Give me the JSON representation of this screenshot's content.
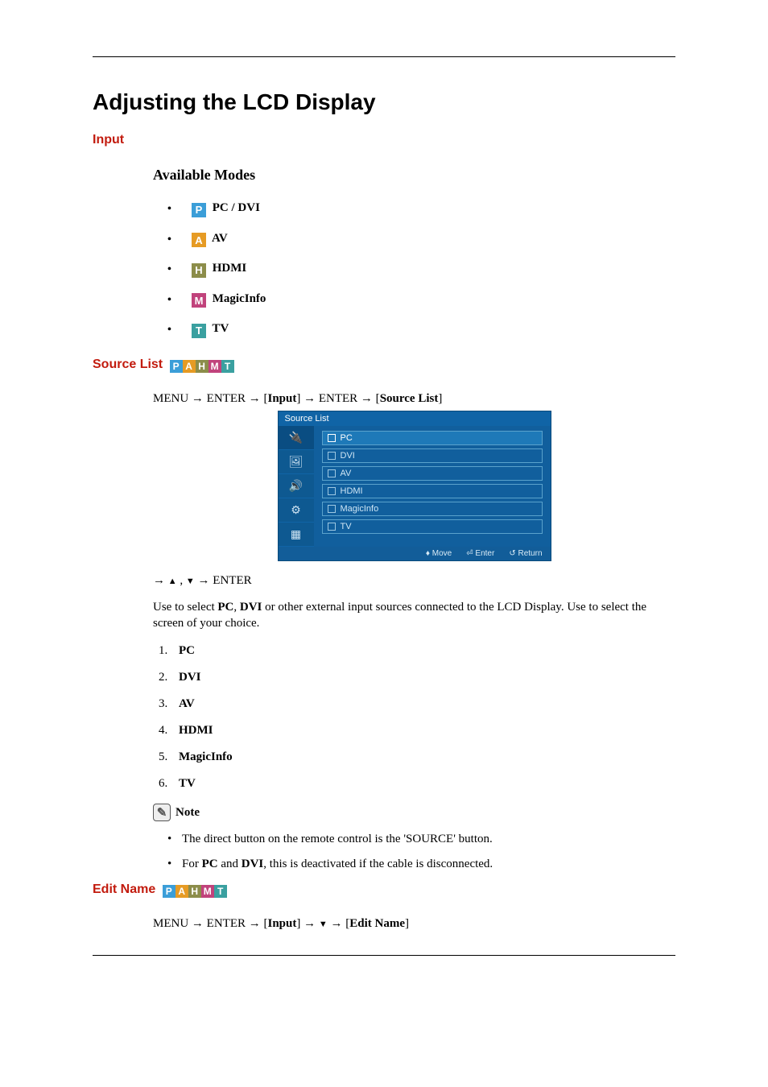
{
  "title": "Adjusting the LCD Display",
  "sections": {
    "input": "Input",
    "available_modes": "Available Modes",
    "source_list": "Source List",
    "edit_name": "Edit Name"
  },
  "mode_chips": {
    "P": "P",
    "A": "A",
    "H": "H",
    "M": "M",
    "T": "T"
  },
  "modes": [
    {
      "chip": "P",
      "chipClass": "chip-p",
      "label": "PC / DVI"
    },
    {
      "chip": "A",
      "chipClass": "chip-a",
      "label": "AV"
    },
    {
      "chip": "H",
      "chipClass": "chip-h",
      "label": "HDMI"
    },
    {
      "chip": "M",
      "chipClass": "chip-m",
      "label": "MagicInfo"
    },
    {
      "chip": "T",
      "chipClass": "chip-t",
      "label": "TV"
    }
  ],
  "source_list_path": {
    "p1": "MENU → ENTER → [",
    "b1": "Input",
    "p2": "] → ENTER → [",
    "b2": "Source List",
    "p3": "]"
  },
  "osd": {
    "title": "Source List",
    "items": [
      "PC",
      "DVI",
      "AV",
      "HDMI",
      "MagicInfo",
      "TV"
    ],
    "foot_move": "Move",
    "foot_enter": "Enter",
    "foot_return": "Return"
  },
  "control_line": {
    "pre": "→ ",
    "up": "▲",
    "sep": " , ",
    "down": "▼",
    "post": " → ENTER"
  },
  "desc": {
    "t1": "Use to select ",
    "b1": "PC",
    "t2": ", ",
    "b2": "DVI",
    "t3": " or other external input sources connected to the LCD Display. Use to select the screen of your choice."
  },
  "numlist": [
    "PC",
    "DVI",
    "AV",
    "HDMI",
    "MagicInfo",
    "TV"
  ],
  "note_label": "Note",
  "notes": {
    "n1": "The direct button on the remote control is the 'SOURCE' button.",
    "n2a": "For ",
    "n2b1": "PC",
    "n2b": " and ",
    "n2b2": "DVI",
    "n2c": ", this is deactivated if the cable is disconnected."
  },
  "edit_name_path": {
    "p1": "MENU → ENTER → [",
    "b1": "Input",
    "p2": "] → ",
    "down": "▼",
    "p3": " → [",
    "b2": "Edit Name",
    "p4": "]"
  }
}
